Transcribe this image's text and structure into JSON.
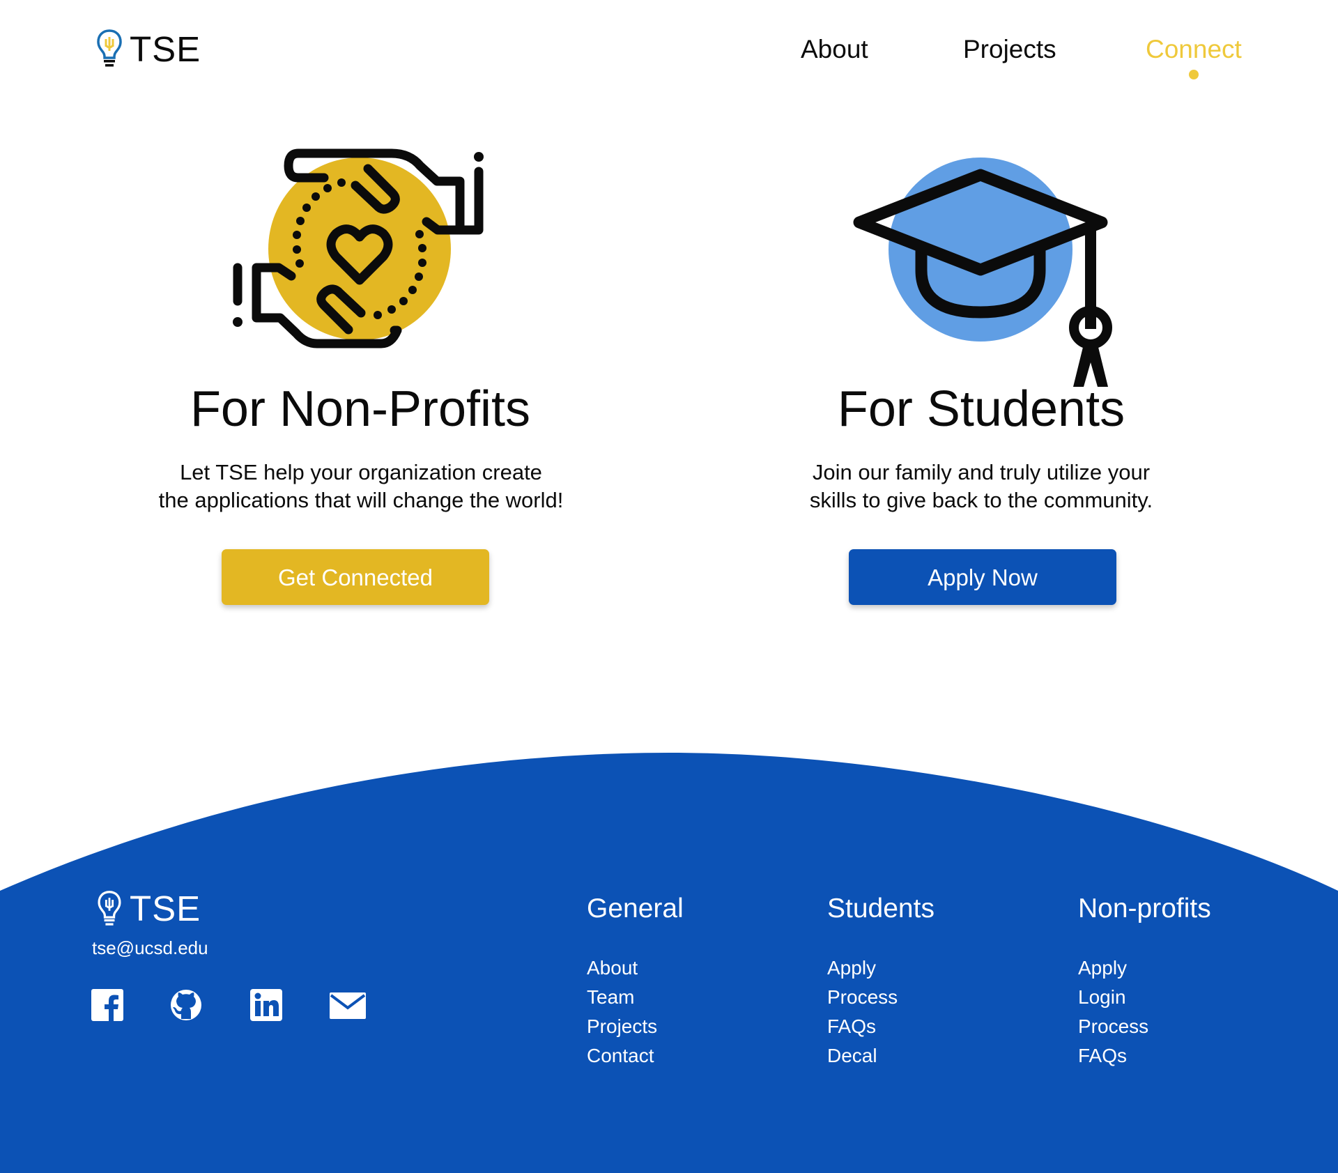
{
  "brand": {
    "name": "TSE",
    "accent_yellow": "#efc93b",
    "accent_blue": "#0c52b5"
  },
  "nav": {
    "items": [
      {
        "label": "About"
      },
      {
        "label": "Projects"
      },
      {
        "label": "Connect",
        "active": true
      }
    ]
  },
  "nonprofits": {
    "icon": "hands-heart-icon",
    "title": "For Non-Profits",
    "description_line1": "Let TSE help your organization create",
    "description_line2": "the applications that will change the world!",
    "button": "Get Connected"
  },
  "students": {
    "icon": "graduation-cap-icon",
    "title": "For Students",
    "description_line1": "Join our family and truly utilize your",
    "description_line2": "skills to give back to the community.",
    "button": "Apply Now"
  },
  "footer": {
    "brand": "TSE",
    "email": "tse@ucsd.edu",
    "social": [
      "facebook-icon",
      "github-icon",
      "linkedin-icon",
      "mail-icon"
    ],
    "columns": [
      {
        "title": "General",
        "links": [
          "About",
          "Team",
          "Projects",
          "Contact"
        ]
      },
      {
        "title": "Students",
        "links": [
          "Apply",
          "Process",
          "FAQs",
          "Decal"
        ]
      },
      {
        "title": "Non-profits",
        "links": [
          "Apply",
          "Login",
          "Process",
          "FAQs"
        ]
      }
    ]
  }
}
